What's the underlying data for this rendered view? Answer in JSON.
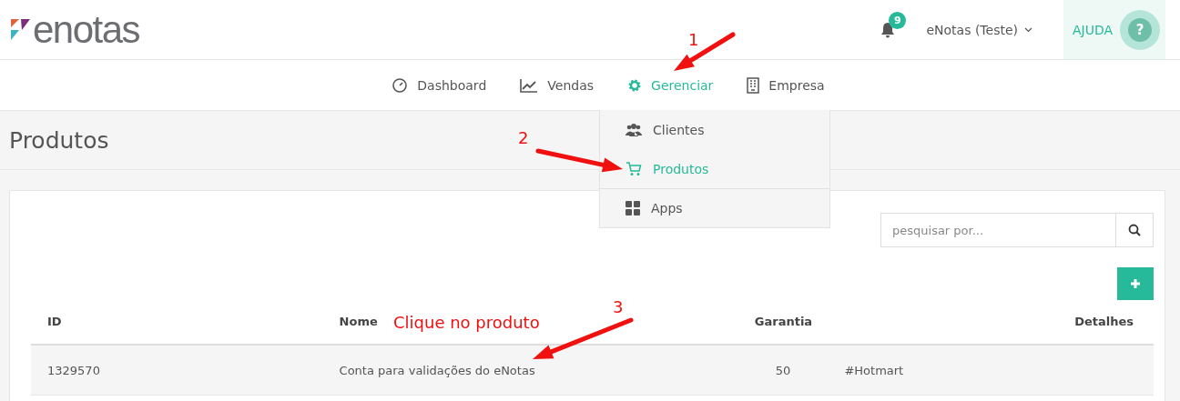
{
  "header": {
    "logo": "enotas",
    "notifications": "9",
    "account": "eNotas (Teste)",
    "help": "AJUDA",
    "help_symbol": "?"
  },
  "nav": [
    {
      "label": "Dashboard",
      "kind": "gauge",
      "selected": false
    },
    {
      "label": "Vendas",
      "kind": "chart",
      "selected": false
    },
    {
      "label": "Gerenciar",
      "kind": "gear",
      "selected": true
    },
    {
      "label": "Empresa",
      "kind": "building",
      "selected": false
    }
  ],
  "dropdown": [
    {
      "label": "Clientes",
      "kind": "users",
      "selected": false
    },
    {
      "label": "Produtos",
      "kind": "cart",
      "selected": true
    },
    {
      "label": "Apps",
      "kind": "grid",
      "selected": false
    }
  ],
  "page_title": "Produtos",
  "search": {
    "placeholder": "pesquisar por..."
  },
  "table": {
    "columns": [
      "ID",
      "Nome",
      "Garantia",
      "",
      "Detalhes"
    ],
    "rows": [
      [
        "1329570",
        "Conta para validações do eNotas",
        "50",
        "#Hotmart",
        ""
      ]
    ]
  },
  "annotations": [
    "1",
    "2",
    "3",
    "Clique no produto"
  ]
}
